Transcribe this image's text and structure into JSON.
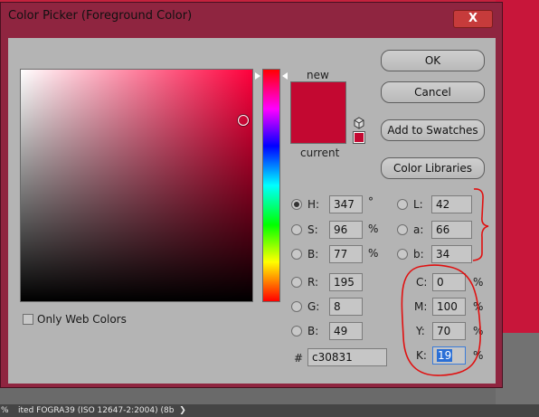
{
  "window": {
    "title": "Color Picker (Foreground Color)",
    "close_glyph": "X"
  },
  "status_bar": {
    "zoom": "%",
    "document_info": "ited FOGRA39 (ISO 12647-2:2004) (8b",
    "arrow": "❯"
  },
  "swatch": {
    "new_label": "new",
    "current_label": "current",
    "new_color": "#c30831",
    "current_color": "#c30831"
  },
  "buttons": {
    "ok": "OK",
    "cancel": "Cancel",
    "add_to_swatches": "Add to Swatches",
    "color_libraries": "Color Libraries"
  },
  "hsb": {
    "h": {
      "label": "H:",
      "value": "347",
      "unit": "°",
      "selected": true
    },
    "s": {
      "label": "S:",
      "value": "96",
      "unit": "%"
    },
    "b": {
      "label": "B:",
      "value": "77",
      "unit": "%"
    }
  },
  "rgb": {
    "r": {
      "label": "R:",
      "value": "195"
    },
    "g": {
      "label": "G:",
      "value": "8"
    },
    "b": {
      "label": "B:",
      "value": "49"
    }
  },
  "lab": {
    "l": {
      "label": "L:",
      "value": "42"
    },
    "a": {
      "label": "a:",
      "value": "66"
    },
    "b": {
      "label": "b:",
      "value": "34"
    }
  },
  "cmyk": {
    "c": {
      "label": "C:",
      "value": "0",
      "unit": "%"
    },
    "m": {
      "label": "M:",
      "value": "100",
      "unit": "%"
    },
    "y": {
      "label": "Y:",
      "value": "70",
      "unit": "%"
    },
    "k": {
      "label": "K:",
      "value": "19",
      "unit": "%"
    }
  },
  "hex": {
    "label": "#",
    "value": "c30831"
  },
  "only_web_colors": {
    "label": "Only Web Colors",
    "checked": false
  },
  "colors": {
    "annotation_red": "#e01010",
    "hue_base": "#ff003c"
  }
}
